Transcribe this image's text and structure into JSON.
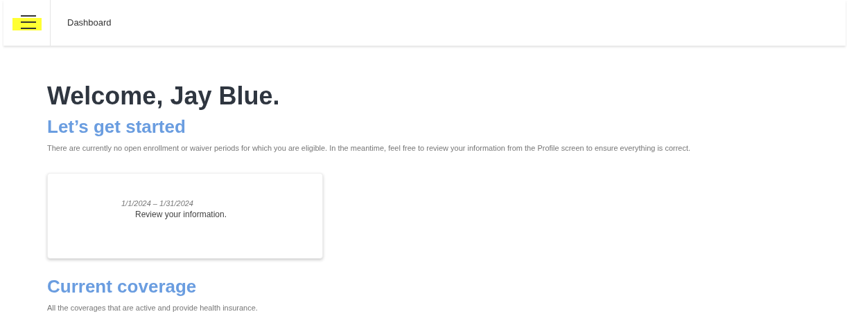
{
  "top_bar": {
    "title": "Dashboard"
  },
  "welcome": "Welcome, Jay Blue.",
  "getting_started": {
    "heading": "Let’s get started",
    "description": "There are currently no open enrollment or waiver periods for which you are eligible. In the meantime, feel free to review your information from the Profile screen to ensure everything is correct."
  },
  "card": {
    "date_range": "1/1/2024 – 1/31/2024",
    "text": "Review your information."
  },
  "current_coverage": {
    "heading": "Current coverage",
    "description": "All the coverages that are active and provide health insurance."
  }
}
